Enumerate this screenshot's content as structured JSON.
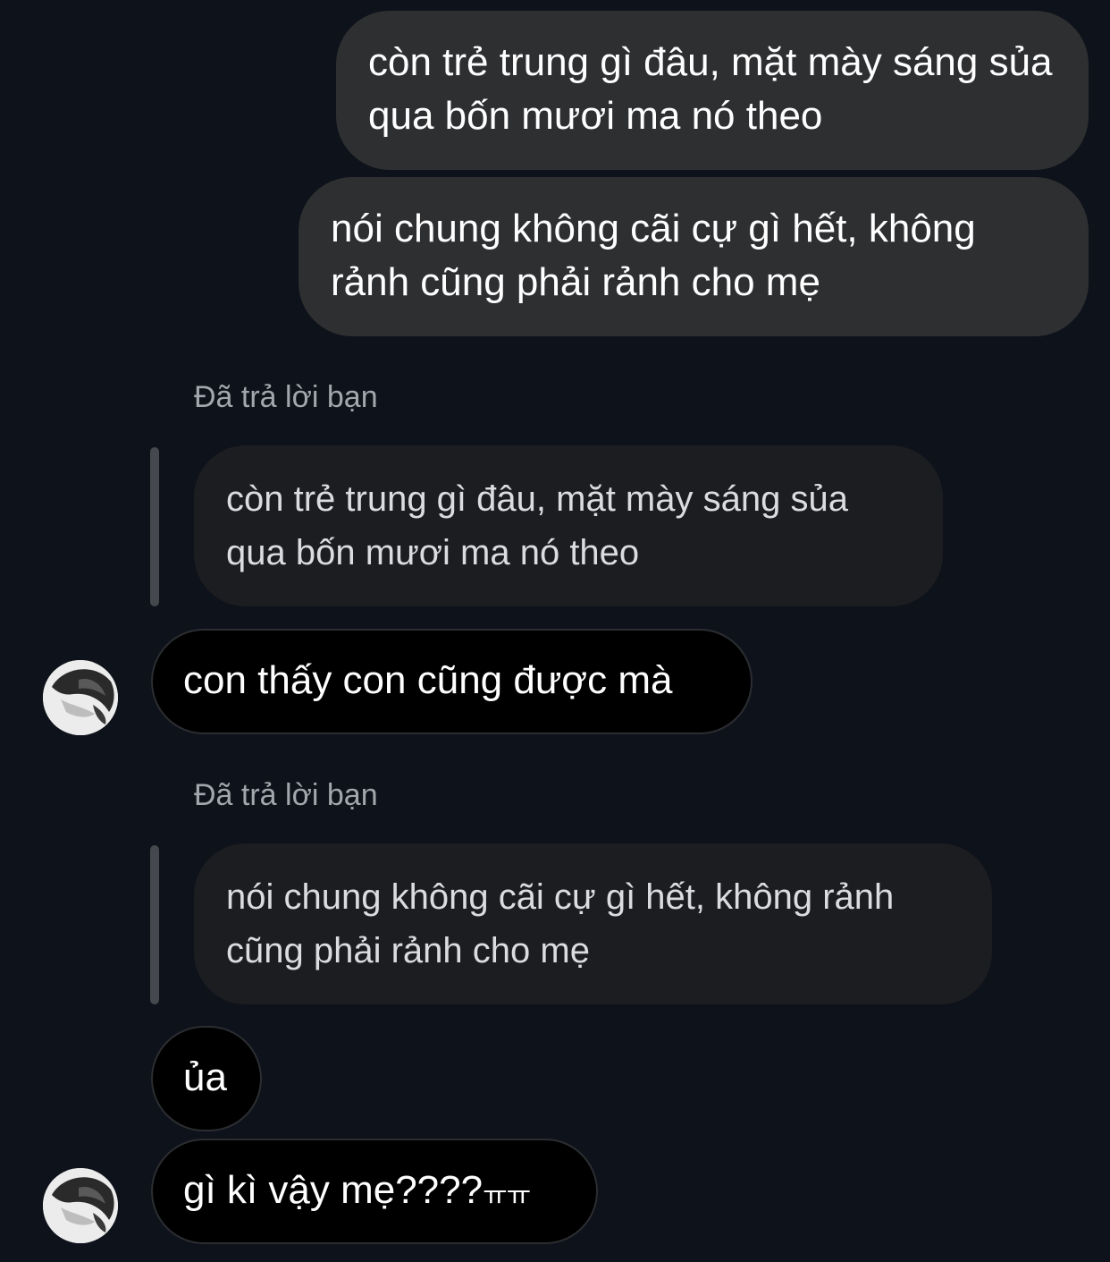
{
  "messages": {
    "sent_1": "còn trẻ trung gì đâu, mặt mày sáng sủa qua bốn mươi ma nó theo",
    "sent_2": "nói chung không cãi cự gì hết, không rảnh cũng phải rảnh cho mẹ",
    "reply_1": {
      "label": "Đã trả lời bạn",
      "quoted": "còn trẻ trung gì đâu, mặt mày sáng sủa qua bốn mươi ma nó theo",
      "text": "con thấy con cũng được mà"
    },
    "reply_2": {
      "label": "Đã trả lời bạn",
      "quoted": "nói chung không cãi cự gì hết, không rảnh cũng phải rảnh cho mẹ",
      "text": "ủa"
    },
    "last": {
      "text": "gì kì vậy mẹ????",
      "suffix": "ㅠㅠ"
    }
  },
  "icons": {
    "avatar": "avatar-photo-icon"
  },
  "colors": {
    "background": "#0e121a",
    "sent_bubble": "#2e2f31",
    "received_bubble": "#000000",
    "quoted_bubble": "#1c1d20",
    "reply_label": "#a3a7ad"
  }
}
